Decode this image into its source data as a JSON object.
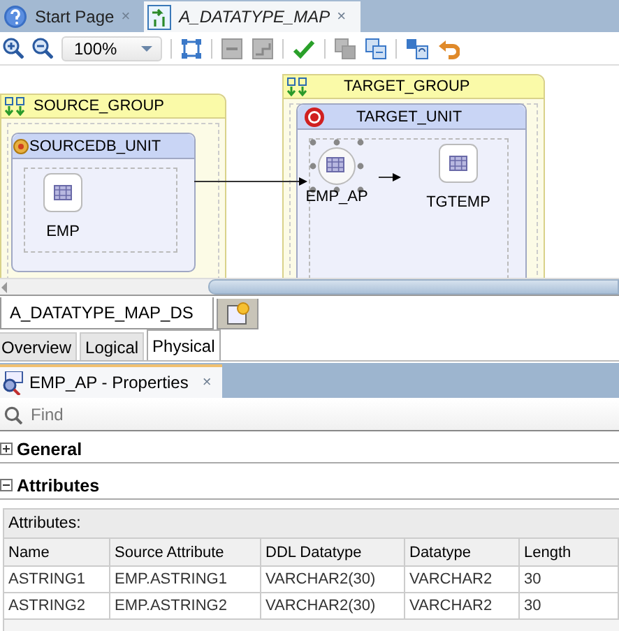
{
  "document_tabs": [
    {
      "label": "Start Page",
      "kind": "help",
      "selected": false,
      "close": "×"
    },
    {
      "label": "A_DATATYPE_MAP",
      "kind": "mapping",
      "selected": true,
      "close": "×"
    }
  ],
  "toolbar": {
    "zoom": "100%"
  },
  "diagram": {
    "groups": [
      {
        "name": "SOURCE_GROUP",
        "units": [
          {
            "name": "SOURCEDB_UNIT",
            "kind": "source",
            "nodes": [
              {
                "label": "EMP",
                "kind": "datastore",
                "selected": false
              }
            ]
          }
        ]
      },
      {
        "name": "TARGET_GROUP",
        "units": [
          {
            "name": "TARGET_UNIT",
            "kind": "target",
            "nodes": [
              {
                "label": "EMP_AP",
                "kind": "access_point",
                "selected": true
              },
              {
                "label": "TGTEMP",
                "kind": "datastore",
                "selected": false
              }
            ]
          }
        ]
      }
    ]
  },
  "editor_tabs": [
    {
      "label": "A_DATATYPE_MAP_DS",
      "selected": true
    }
  ],
  "view_tabs": [
    {
      "label": "Overview",
      "selected": false
    },
    {
      "label": "Logical",
      "selected": false
    },
    {
      "label": "Physical",
      "selected": true
    }
  ],
  "properties": {
    "title": "EMP_AP - Properties",
    "close": "×",
    "search": {
      "placeholder": "Find"
    },
    "sections": [
      {
        "title": "General",
        "expanded": false
      },
      {
        "title": "Attributes",
        "expanded": true
      }
    ],
    "table": {
      "caption": "Attributes:",
      "columns": [
        "Name",
        "Source Attribute",
        "DDL Datatype",
        "Datatype",
        "Length"
      ],
      "rows": [
        [
          "ASTRING1",
          "EMP.ASTRING1",
          "VARCHAR2(30)",
          "VARCHAR2",
          "30"
        ],
        [
          "ASTRING2",
          "EMP.ASTRING2",
          "VARCHAR2(30)",
          "VARCHAR2",
          "30"
        ]
      ]
    }
  }
}
